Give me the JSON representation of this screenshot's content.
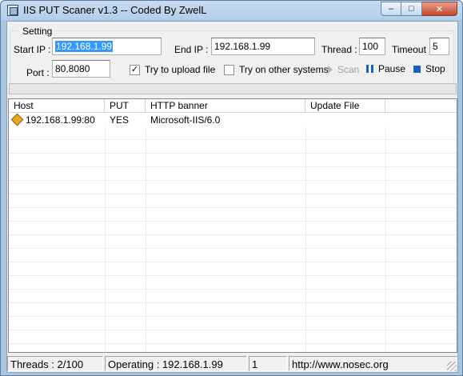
{
  "window": {
    "title": "IIS PUT Scaner v1.3 -- Coded By ZwelL",
    "min_glyph": "–",
    "max_glyph": "□",
    "close_glyph": "✕"
  },
  "settings": {
    "group_title": "Setting",
    "start_ip_label": "Start IP :",
    "start_ip_value": "192.168.1.99",
    "end_ip_label": "End IP :",
    "end_ip_value": "192.168.1.99",
    "thread_label": "Thread :",
    "thread_value": "100",
    "timeout_label": "Timeout :",
    "timeout_value": "5",
    "port_label": "Port :",
    "port_value": "80,8080",
    "upload_label": "Try to upload file",
    "upload_checked": true,
    "upload_mark": "✓",
    "other_systems_label": "Try on other systems",
    "other_systems_checked": false
  },
  "actions": {
    "scan_label": "Scan",
    "pause_label": "Pause",
    "stop_label": "Stop"
  },
  "table": {
    "columns": [
      "Host",
      "PUT",
      "HTTP banner",
      "Update File"
    ],
    "rows": [
      {
        "host": "192.168.1.99:80",
        "put": "YES",
        "banner": "Microsoft-IIS/6.0",
        "update": ""
      }
    ]
  },
  "status": {
    "threads": "Threads : 2/100",
    "operating": "Operating : 192.168.1.99",
    "count": "1",
    "url": "http://www.nosec.org"
  },
  "colors": {
    "selection": "#3399ff",
    "action_icon": "#1c5fb5"
  }
}
